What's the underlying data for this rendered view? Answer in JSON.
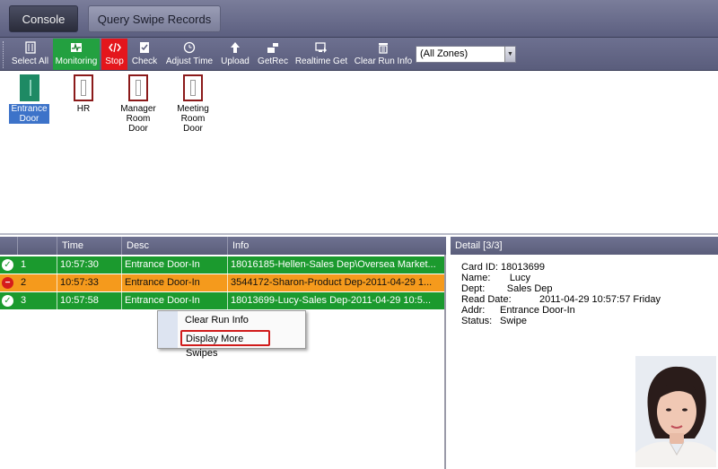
{
  "header": {
    "console_label": "Console",
    "query_label": "Query Swipe Records"
  },
  "toolbar": {
    "items": [
      {
        "label": "Select All",
        "icon": "select-all-icon"
      },
      {
        "label": "Monitoring",
        "icon": "monitoring-icon"
      },
      {
        "label": "Stop",
        "icon": "stop-icon"
      },
      {
        "label": "Check",
        "icon": "check-icon"
      },
      {
        "label": "Adjust Time",
        "icon": "clock-icon"
      },
      {
        "label": "Upload",
        "icon": "upload-icon"
      },
      {
        "label": "GetRec",
        "icon": "getrec-icon"
      },
      {
        "label": "Realtime Get",
        "icon": "realtime-get-icon"
      },
      {
        "label": "Clear Run Info",
        "icon": "trash-icon"
      }
    ],
    "zone_select": "(All Zones)"
  },
  "doors": [
    {
      "line1": "Entrance",
      "line2": "Door",
      "selected": true,
      "open": true
    },
    {
      "line1": "HR",
      "line2": "",
      "selected": false,
      "open": false
    },
    {
      "line1": "Manager",
      "line2": "Room Door",
      "selected": false,
      "open": false
    },
    {
      "line1": "Meeting",
      "line2": "Room Door",
      "selected": false,
      "open": false
    }
  ],
  "grid": {
    "columns": [
      "Time",
      "Desc",
      "Info"
    ],
    "rows": [
      {
        "num": "1",
        "time": "10:57:30",
        "desc": "Entrance Door-In",
        "info": "18016185-Hellen-Sales Dep\\Oversea Market...",
        "status": "ok"
      },
      {
        "num": "2",
        "time": "10:57:33",
        "desc": "Entrance Door-In",
        "info": "3544172-Sharon-Product Dep-2011-04-29 1...",
        "status": "err"
      },
      {
        "num": "3",
        "time": "10:57:58",
        "desc": "Entrance Door-In",
        "info": "18013699-Lucy-Sales Dep-2011-04-29 10:5...",
        "status": "ok"
      }
    ]
  },
  "context_menu": {
    "items": [
      "Clear Run Info",
      "Display More Swipes"
    ]
  },
  "detail": {
    "header": "Detail  [3/3]",
    "card_label": "Card ID:",
    "card_value": "18013699",
    "name_label": "Name:",
    "name_value": "Lucy",
    "dept_label": "Dept:",
    "dept_value": "Sales Dep",
    "read_date_label": "Read Date:",
    "read_date_value": "2011-04-29 10:57:57 Friday",
    "addr_label": "Addr:",
    "addr_value": "Entrance Door-In",
    "status_label": "Status:",
    "status_value": "Swipe"
  }
}
